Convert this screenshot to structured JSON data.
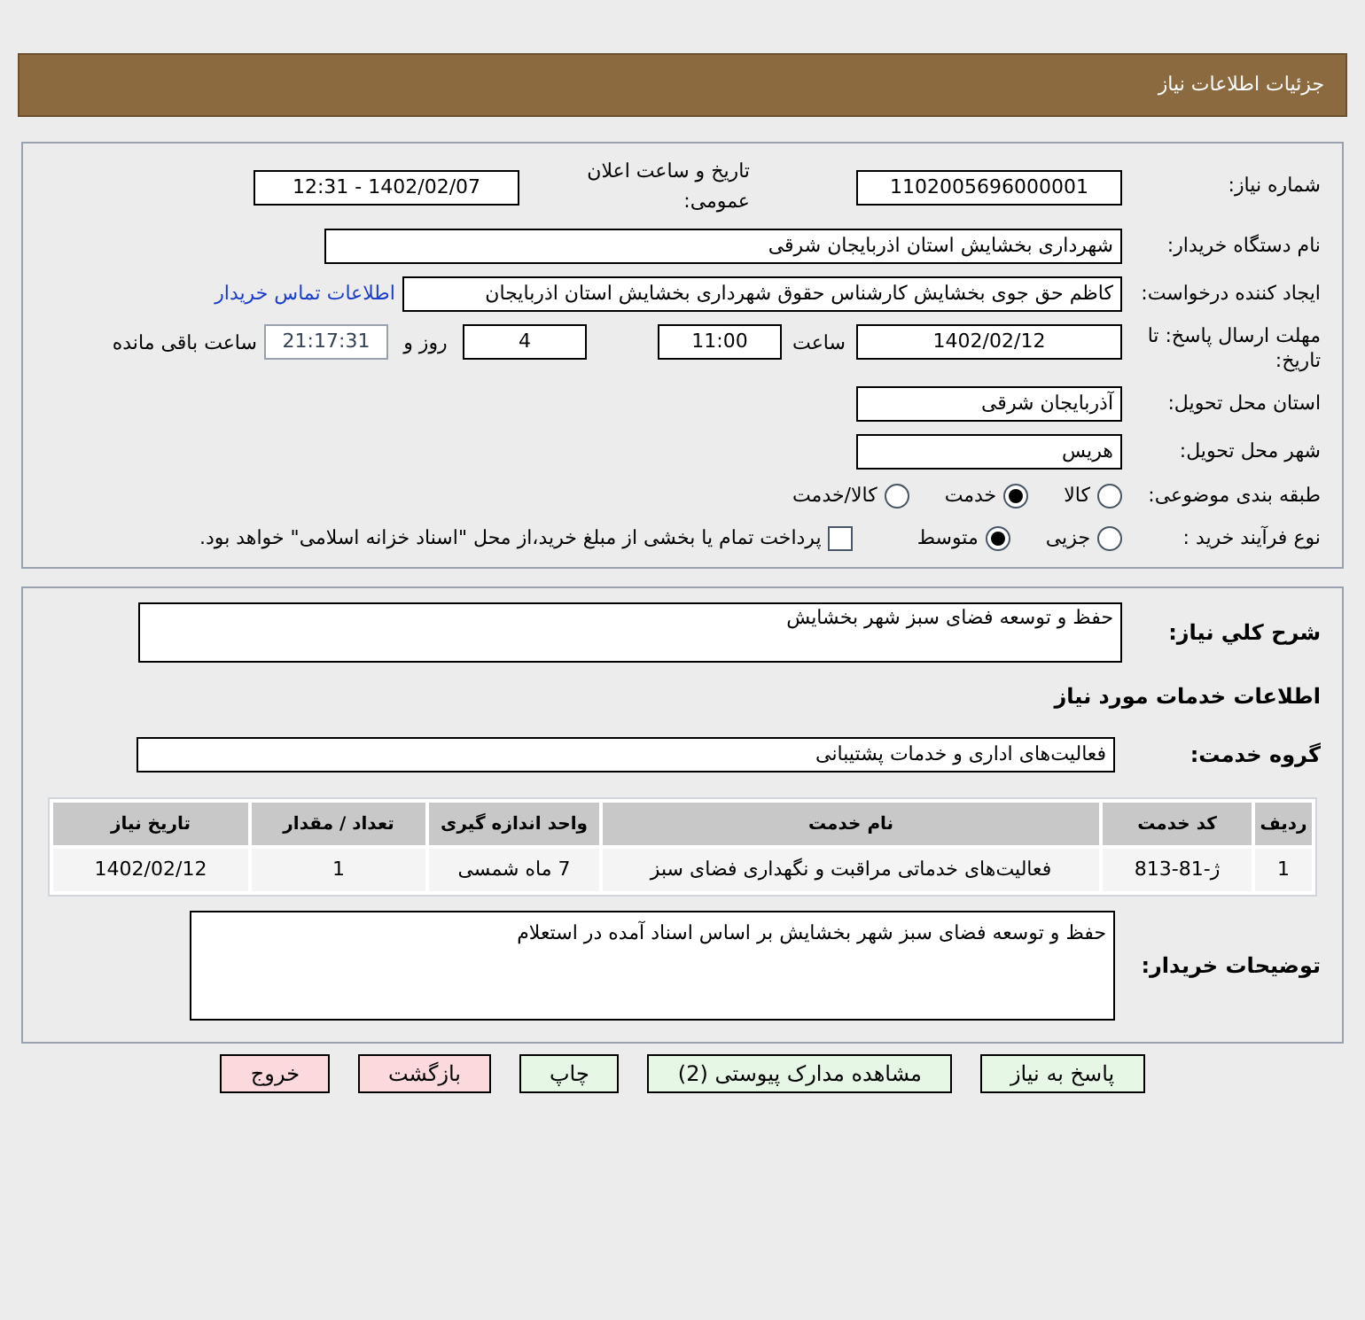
{
  "header": {
    "title": "جزئیات اطلاعات نیاز"
  },
  "need_number": {
    "label": "شماره نیاز:",
    "value": "1102005696000001"
  },
  "announce": {
    "label": "تاریخ و ساعت اعلان عمومی:",
    "value": "1402/02/07 - 12:31"
  },
  "buyer_org": {
    "label": "نام دستگاه خریدار:",
    "value": "شهرداری بخشایش استان اذربایجان شرقی"
  },
  "requester": {
    "label": "ایجاد کننده درخواست:",
    "value": "کاظم حق جوی بخشایش کارشناس حقوق شهرداری بخشایش استان اذربایجان",
    "link": "اطلاعات تماس خریدار"
  },
  "deadline": {
    "label": "مهلت ارسال پاسخ: تا تاریخ:",
    "date": "1402/02/12",
    "time_label": "ساعت",
    "time": "11:00",
    "days": "4",
    "days_label": "روز و",
    "remaining": "21:17:31",
    "remaining_label": "ساعت باقی مانده"
  },
  "province": {
    "label": "استان محل تحویل:",
    "value": "آذربایجان شرقی"
  },
  "city": {
    "label": "شهر محل تحویل:",
    "value": "هریس"
  },
  "category": {
    "label": "طبقه بندی موضوعی:",
    "options": [
      {
        "label": "کالا",
        "selected": false
      },
      {
        "label": "خدمت",
        "selected": true
      },
      {
        "label": "کالا/خدمت",
        "selected": false
      }
    ]
  },
  "process": {
    "label": "نوع فرآیند خرید :",
    "options": [
      {
        "label": "جزیی",
        "selected": false
      },
      {
        "label": "متوسط",
        "selected": true
      }
    ],
    "checkbox": {
      "label": "پرداخت تمام یا بخشی از مبلغ خرید،از محل \"اسناد خزانه اسلامی\" خواهد بود.",
      "checked": false
    }
  },
  "description": {
    "label": "شرح کلي نياز:",
    "value": "حفظ و توسعه فضای سبز شهر بخشایش"
  },
  "services_title": "اطلاعات خدمات مورد نیاز",
  "service_group": {
    "label": "گروه خدمت:",
    "value": "فعالیت‌های اداری و خدمات پشتیبانی"
  },
  "table": {
    "columns": [
      "ردیف",
      "کد خدمت",
      "نام خدمت",
      "واحد اندازه گیری",
      "تعداد / مقدار",
      "تاریخ نیاز"
    ],
    "rows": [
      [
        "1",
        "ژ-81-813",
        "فعالیت‌های خدماتی مراقبت و نگهداری فضای سبز",
        "7 ماه شمسی",
        "1",
        "1402/02/12"
      ]
    ]
  },
  "buyer_notes": {
    "label": "توضیحات خریدار:",
    "value": "حفظ و توسعه فضای سبز شهر بخشایش بر اساس اسناد آمده در استعلام"
  },
  "buttons": [
    {
      "label": "پاسخ به نیاز",
      "kind": "green"
    },
    {
      "label": "مشاهده مدارک پیوستی (2)",
      "kind": "green"
    },
    {
      "label": "چاپ",
      "kind": "green"
    },
    {
      "label": "بازگشت",
      "kind": "red"
    },
    {
      "label": "خروج",
      "kind": "red"
    }
  ]
}
